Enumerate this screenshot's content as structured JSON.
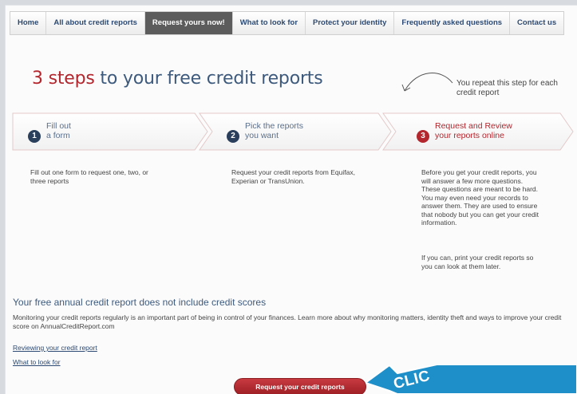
{
  "nav": {
    "items": [
      {
        "label": "Home"
      },
      {
        "label": "All about credit reports"
      },
      {
        "label": "Request yours now!"
      },
      {
        "label": "What to look for"
      },
      {
        "label": "Protect your identity"
      },
      {
        "label": "Frequently asked questions"
      },
      {
        "label": "Contact us"
      }
    ],
    "active_index": 2
  },
  "title": {
    "accent": "3 steps",
    "rest": " to your free credit reports"
  },
  "repeat_note": "You repeat this step for each credit report",
  "steps": [
    {
      "number": "1",
      "label_line1": "Fill out",
      "label_line2": "a form",
      "description": "Fill out one form to request one, two, or three reports"
    },
    {
      "number": "2",
      "label_line1": "Pick the reports",
      "label_line2": "you want",
      "description": "Request your credit reports from Equifax, Experian or TransUnion."
    },
    {
      "number": "3",
      "label_line1": "Request and Review",
      "label_line2": "your reports online",
      "description": "Before you get your credit reports, you will answer a few more questions. These questions are meant to be hard. You may even need your records to answer them. They are used to ensure that nobody but you can get your credit information.",
      "description2": "If you can, print your credit reports so you can look at them later."
    }
  ],
  "section": {
    "heading": "Your free annual credit report does not include credit scores",
    "body": "Monitoring your credit reports regularly is an important part of being in control of your finances. Learn more about why monitoring matters, identity theft and ways to improve your credit score on AnnualCreditReport.com"
  },
  "links": {
    "reviewing": "Reviewing your credit report",
    "what_to_look_for": "What to look for"
  },
  "cta_label": "Request your credit reports",
  "callout_text": "CLIC",
  "colors": {
    "accent_red": "#b3262d",
    "navy": "#2a3f5c",
    "title_blue": "#3d5a7d",
    "callout_blue": "#1f8fc9"
  }
}
